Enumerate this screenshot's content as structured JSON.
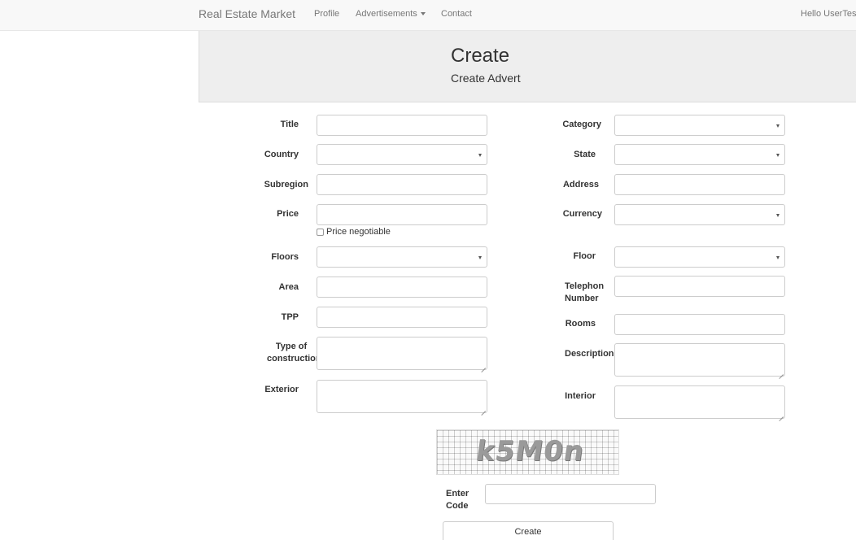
{
  "navbar": {
    "brand": "Real Estate Market",
    "links": [
      "Profile",
      "Advertisements",
      "Contact"
    ],
    "greeting": "Hello UserTest"
  },
  "header": {
    "title": "Create",
    "subtitle": "Create Advert"
  },
  "form": {
    "title_label": "Title",
    "country_label": "Country",
    "subregion_label": "Subregion",
    "price_label": "Price",
    "price_negotiable_label": "Price negotiable",
    "floors_label": "Floors",
    "area_label": "Area",
    "tpp_label": "TPP",
    "type_of_construction_label": "Type of construction",
    "exterior_label": "Exterior",
    "category_label": "Category",
    "state_label": "State",
    "address_label": "Address",
    "currency_label": "Currency",
    "floor_label": "Floor",
    "telephone_label": "Telephon Number",
    "rooms_label": "Rooms",
    "description_label": "Description",
    "interior_label": "Interior"
  },
  "captcha": {
    "text": "k5M0n",
    "enter_code_label": "Enter Code"
  },
  "submit_label": "Create"
}
